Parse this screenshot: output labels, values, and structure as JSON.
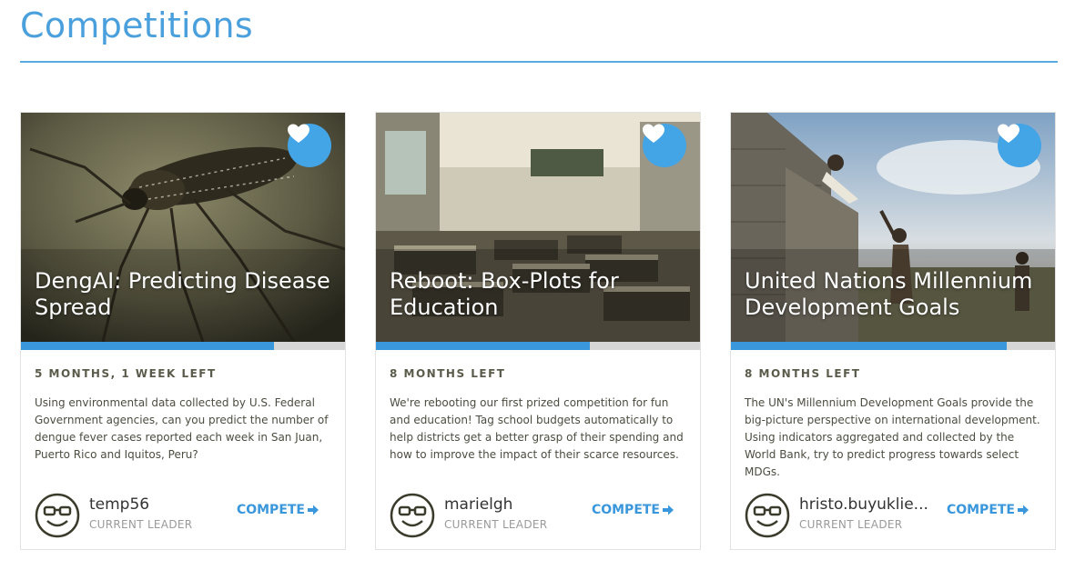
{
  "page": {
    "title": "Competitions"
  },
  "colors": {
    "accent": "#3a97dc",
    "title": "#4aa0dc",
    "favorite_bg": "#43a4e6",
    "progress_track": "#d6d6d6"
  },
  "cards": [
    {
      "title": "DengAI: Predicting Disease Spread",
      "time_left": "5 MONTHS, 1 WEEK LEFT",
      "description": "Using environmental data collected by U.S. Federal Government agencies, can you predict the number of dengue fever cases reported each week in San Juan, Puerto Rico and Iquitos, Peru?",
      "progress": 0.78,
      "leader_name": "temp56",
      "leader_caption": "CURRENT LEADER",
      "compete_label": "COMPETE",
      "icons": {
        "favorite": "heart-icon",
        "avatar": "smiley-glasses-avatar",
        "arrow": "arrow-right-icon"
      }
    },
    {
      "title": "Reboot: Box-Plots for Education",
      "time_left": "8 MONTHS LEFT",
      "description": "We're rebooting our first prized competition for fun and education! Tag school budgets automatically to help districts get a better grasp of their spending and how to improve the impact of their scarce resources.",
      "progress": 0.66,
      "leader_name": "marielgh",
      "leader_caption": "CURRENT LEADER",
      "compete_label": "COMPETE",
      "icons": {
        "favorite": "heart-icon",
        "avatar": "smiley-glasses-avatar",
        "arrow": "arrow-right-icon"
      }
    },
    {
      "title": "United Nations Millennium Development Goals",
      "time_left": "8 MONTHS LEFT",
      "description": "The UN's Millennium Development Goals provide the big-picture perspective on international development. Using indicators aggregated and collected by the World Bank, try to predict progress towards select MDGs.",
      "progress": 0.85,
      "leader_name": "hristo.buyuklie...",
      "leader_caption": "CURRENT LEADER",
      "compete_label": "COMPETE",
      "icons": {
        "favorite": "heart-icon",
        "avatar": "smiley-glasses-avatar",
        "arrow": "arrow-right-icon"
      }
    }
  ]
}
